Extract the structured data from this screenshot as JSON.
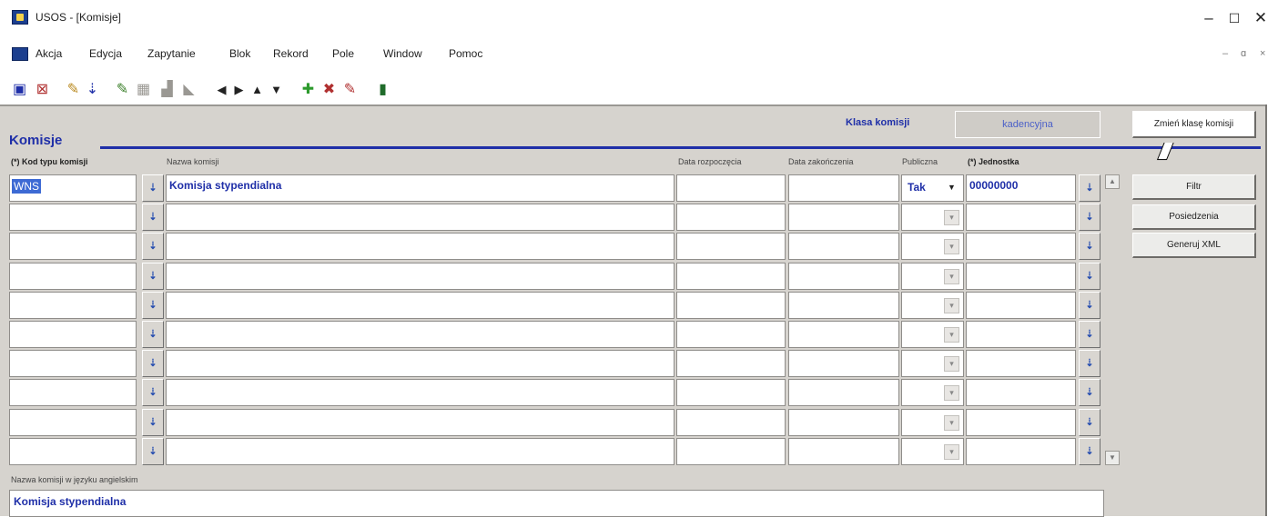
{
  "window": {
    "title": "USOS - [Komisje]",
    "minimize": "–",
    "maximize": "☐",
    "close": "✕"
  },
  "menu": {
    "items": [
      "Akcja",
      "Edycja",
      "Zapytanie",
      "Blok",
      "Rekord",
      "Pole",
      "Window",
      "Pomoc"
    ],
    "mdi_buttons": [
      "–",
      "ɑ",
      "×"
    ]
  },
  "toolbar": {
    "icons": [
      "save-icon",
      "exit-red-icon",
      "edit-icon",
      "download-icon",
      "query-icon",
      "grid-icon",
      "chart-icon",
      "bookmark-icon",
      "prev-icon",
      "next-icon",
      "up-icon",
      "down-icon",
      "add-record-icon",
      "delete-record-icon",
      "clear-icon",
      "door-icon"
    ]
  },
  "form": {
    "block_title": "Komisje",
    "klasa_label": "Klasa komisji",
    "klasa_value": "kadencyjna",
    "button_change_class": "Zmień klasę komisji",
    "columns": {
      "kod": "(*) Kod typu komisji",
      "nazwa": "Nazwa komisji",
      "data_rozp": "Data rozpoczęcia",
      "data_zak": "Data zakończenia",
      "publiczna": "Publiczna",
      "jednostka": "(*) Jednostka"
    },
    "rows": [
      {
        "kod": "WNS",
        "nazwa": "Komisja stypendialna",
        "data_rozp": "",
        "data_zak": "",
        "publiczna": "Tak",
        "jednostka": "00000000"
      },
      {
        "kod": "",
        "nazwa": "",
        "data_rozp": "",
        "data_zak": "",
        "publiczna": "",
        "jednostka": ""
      },
      {
        "kod": "",
        "nazwa": "",
        "data_rozp": "",
        "data_zak": "",
        "publiczna": "",
        "jednostka": ""
      },
      {
        "kod": "",
        "nazwa": "",
        "data_rozp": "",
        "data_zak": "",
        "publiczna": "",
        "jednostka": ""
      },
      {
        "kod": "",
        "nazwa": "",
        "data_rozp": "",
        "data_zak": "",
        "publiczna": "",
        "jednostka": ""
      },
      {
        "kod": "",
        "nazwa": "",
        "data_rozp": "",
        "data_zak": "",
        "publiczna": "",
        "jednostka": ""
      },
      {
        "kod": "",
        "nazwa": "",
        "data_rozp": "",
        "data_zak": "",
        "publiczna": "",
        "jednostka": ""
      },
      {
        "kod": "",
        "nazwa": "",
        "data_rozp": "",
        "data_zak": "",
        "publiczna": "",
        "jednostka": ""
      },
      {
        "kod": "",
        "nazwa": "",
        "data_rozp": "",
        "data_zak": "",
        "publiczna": "",
        "jednostka": ""
      },
      {
        "kod": "",
        "nazwa": "",
        "data_rozp": "",
        "data_zak": "",
        "publiczna": "",
        "jednostka": ""
      }
    ],
    "side_buttons": [
      "Filtr",
      "Posiedzenia",
      "Generuj XML"
    ],
    "english_name_label": "Nazwa komisji w języku angielskim",
    "english_name_value": "Komisja stypendialna"
  }
}
